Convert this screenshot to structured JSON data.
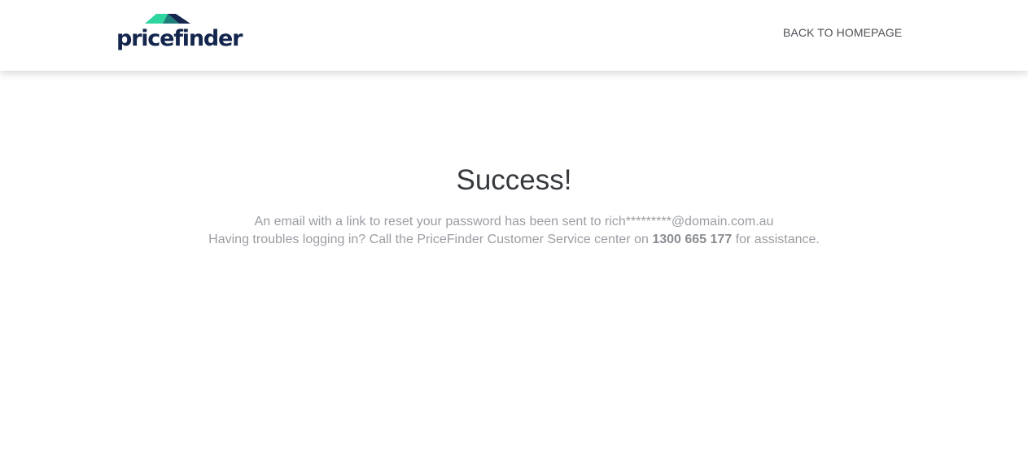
{
  "header": {
    "logo_text": "pricefinder",
    "back_link_label": "BACK TO HOMEPAGE"
  },
  "main": {
    "title": "Success!",
    "message_line1": "An email with a link to reset your password has been sent to rich*********@domain.com.au",
    "message_line2_before": "Having troubles logging in? Call the PriceFinder Customer Service center on",
    "phone_number": "1300 665 177",
    "message_line2_after": "for assistance."
  },
  "colors": {
    "brand_navy": "#14264e",
    "brand_green": "#2ed5a0",
    "text_gray": "#9a9da2",
    "title_dark": "#36393d"
  }
}
